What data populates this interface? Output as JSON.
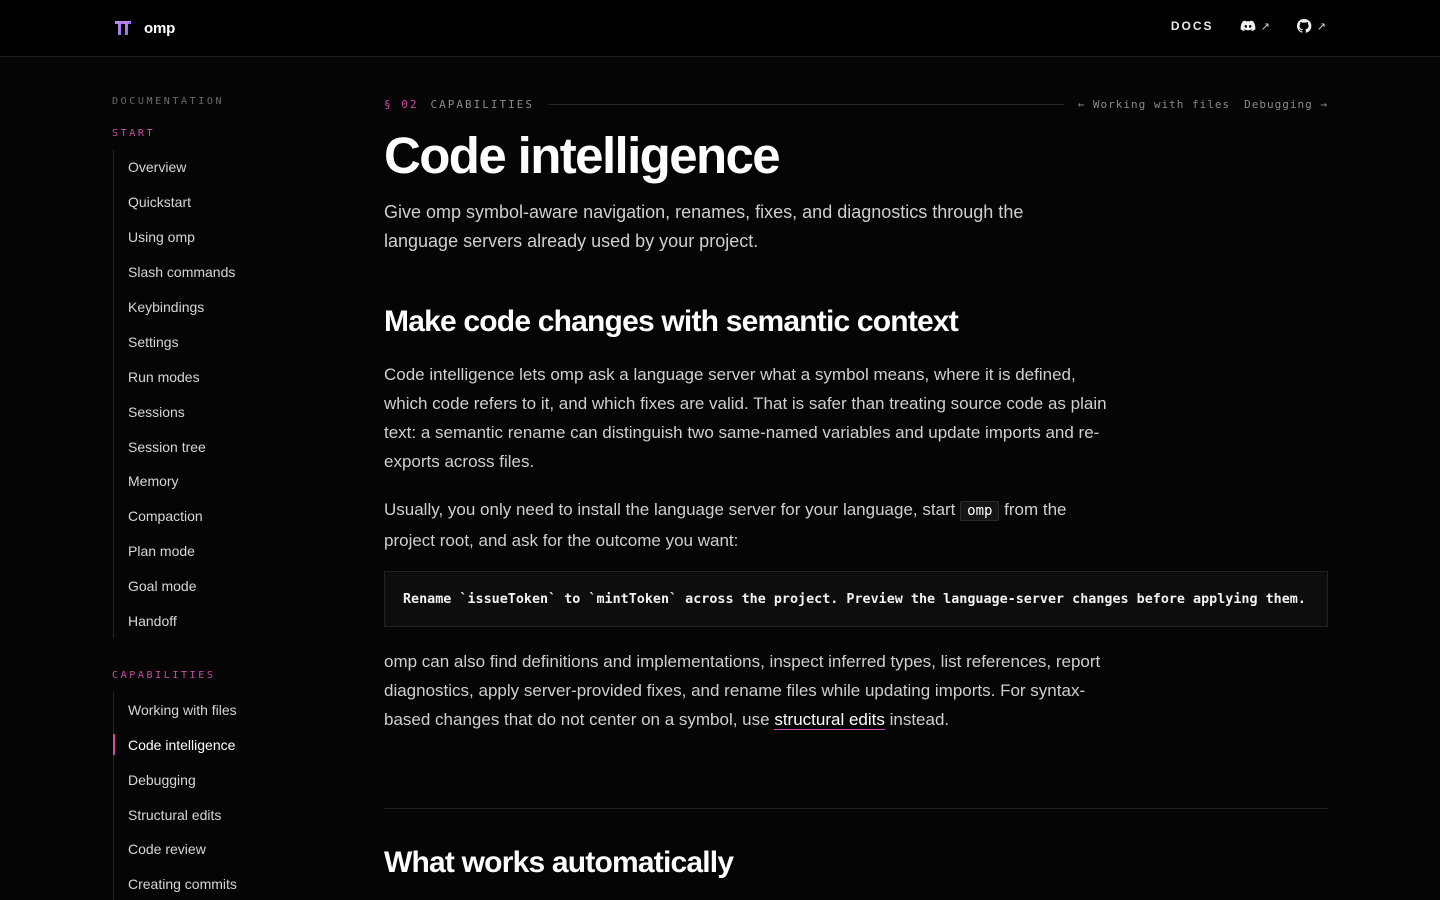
{
  "header": {
    "brand_name": "omp",
    "docs_label": "DOCS",
    "discord_arrow": "↗",
    "github_arrow": "↗"
  },
  "sidebar": {
    "heading": "DOCUMENTATION",
    "sections": [
      {
        "title": "START",
        "items": [
          {
            "label": "Overview"
          },
          {
            "label": "Quickstart"
          },
          {
            "label": "Using omp"
          },
          {
            "label": "Slash commands"
          },
          {
            "label": "Keybindings"
          },
          {
            "label": "Settings"
          },
          {
            "label": "Run modes"
          },
          {
            "label": "Sessions"
          },
          {
            "label": "Session tree"
          },
          {
            "label": "Memory"
          },
          {
            "label": "Compaction"
          },
          {
            "label": "Plan mode"
          },
          {
            "label": "Goal mode"
          },
          {
            "label": "Handoff"
          }
        ]
      },
      {
        "title": "CAPABILITIES",
        "items": [
          {
            "label": "Working with files"
          },
          {
            "label": "Code intelligence",
            "active": true
          },
          {
            "label": "Debugging"
          },
          {
            "label": "Structural edits"
          },
          {
            "label": "Code review"
          },
          {
            "label": "Creating commits"
          }
        ]
      }
    ]
  },
  "breadcrumb": {
    "section_number": "§ 02",
    "section_name": "CAPABILITIES",
    "prev_label": "← Working with files",
    "next_label": "Debugging →"
  },
  "article": {
    "title": "Code intelligence",
    "lead": "Give omp symbol-aware navigation, renames, fixes, and diagnostics through the language servers already used by your project.",
    "section1_heading": "Make code changes with semantic context",
    "p1": "Code intelligence lets omp ask a language server what a symbol means, where it is defined, which code refers to it, and which fixes are valid. That is safer than treating source code as plain text: a semantic rename can distinguish two same-named variables and update imports and re-exports across files.",
    "p2_before": "Usually, you only need to install the language server for your language, start ",
    "p2_code": "omp",
    "p2_after": " from the project root, and ask for the outcome you want:",
    "code_example": "Rename `issueToken` to `mintToken` across the project. Preview the language-server changes before applying them.",
    "p3_before": "omp can also find definitions and implementations, inspect inferred types, list references, report diagnostics, apply server-provided fixes, and rename files while updating imports. For syntax-based changes that do not center on a symbol, use ",
    "p3_link": "structural edits",
    "p3_after": " instead.",
    "section2_heading": "What works automatically"
  },
  "colors": {
    "accent": "#d04aa8",
    "background": "#050505",
    "topbar": "#000000"
  }
}
